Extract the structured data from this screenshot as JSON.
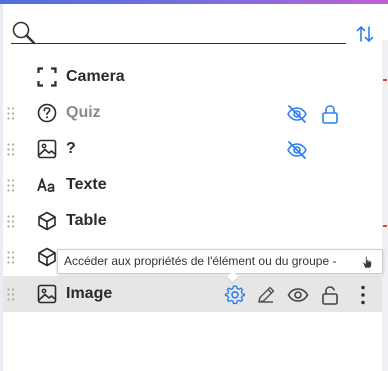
{
  "search": {
    "placeholder": "",
    "value": ""
  },
  "layers": [
    {
      "label": "Camera",
      "icon": "camera-frame-icon",
      "muted": false
    },
    {
      "label": "Quiz",
      "icon": "question-circle-icon",
      "muted": true,
      "hidden": true,
      "locked": true
    },
    {
      "label": "?",
      "icon": "image-icon",
      "muted": false,
      "hidden": true
    },
    {
      "label": "Texte",
      "icon": "text-aa-icon",
      "muted": false
    },
    {
      "label": "Table",
      "icon": "cube-icon",
      "muted": false
    },
    {
      "label": "",
      "icon": "cube-icon",
      "muted": false
    },
    {
      "label": "Image",
      "icon": "image-icon",
      "muted": false,
      "selected": true
    }
  ],
  "tooltip": {
    "text": "Accéder aux propriétés de l'élément ou du groupe -"
  },
  "colors": {
    "accent": "#2f80ed",
    "text": "#2b2b2b",
    "muted": "#8a8a8a",
    "selected_row": "#e6e6e6"
  }
}
